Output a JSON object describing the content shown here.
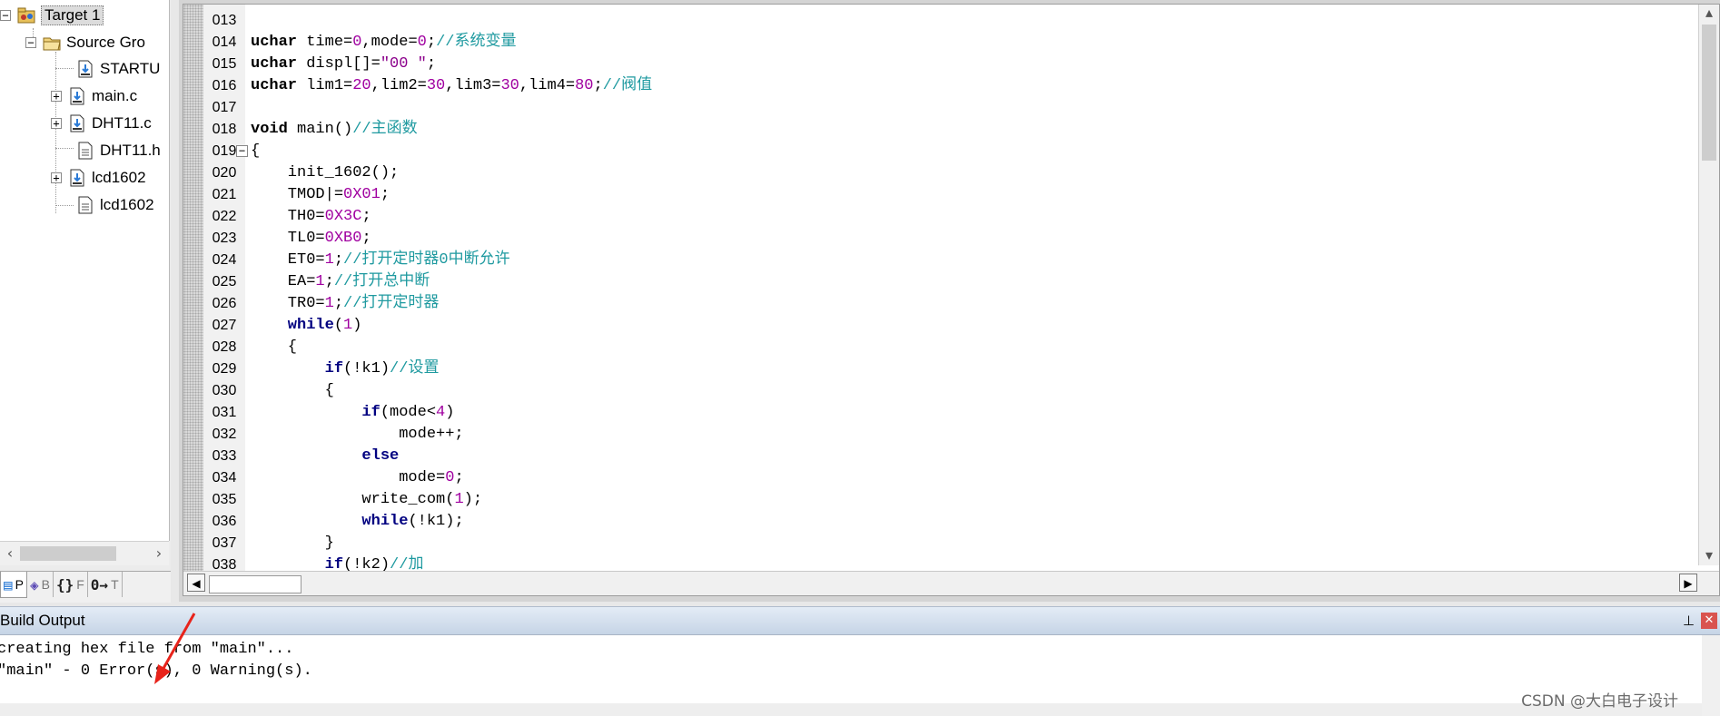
{
  "project": {
    "tree": [
      {
        "label": "Target 1",
        "expander": "⊟",
        "icon": "target-folder-icon",
        "selected": true
      },
      {
        "label": "Source Gro",
        "expander": "⊟",
        "icon": "folder-open-icon"
      },
      {
        "label": "STARTU",
        "expander": "",
        "icon": "asm-file-icon"
      },
      {
        "label": "main.c",
        "expander": "+",
        "icon": "c-file-icon"
      },
      {
        "label": "DHT11.c",
        "expander": "+",
        "icon": "c-file-icon"
      },
      {
        "label": "DHT11.h",
        "expander": "",
        "icon": "header-file-icon"
      },
      {
        "label": "lcd1602",
        "expander": "+",
        "icon": "c-file-icon"
      },
      {
        "label": "lcd1602",
        "expander": "",
        "icon": "header-file-icon"
      }
    ],
    "tabs": [
      {
        "glyph": "▤",
        "label": "P",
        "active": true
      },
      {
        "glyph": "◈",
        "label": "B"
      },
      {
        "glyph": "{}",
        "label": "F"
      },
      {
        "glyph": "0→",
        "label": "T"
      }
    ]
  },
  "editor": {
    "lines": [
      {
        "n": "013",
        "tokens": []
      },
      {
        "n": "014",
        "tokens": [
          [
            "kwp",
            "uchar"
          ],
          [
            "op",
            " time="
          ],
          [
            "num",
            "0"
          ],
          [
            "op",
            ",mode="
          ],
          [
            "num",
            "0"
          ],
          [
            "op",
            ";"
          ],
          [
            "cmt",
            "//系统变量"
          ]
        ]
      },
      {
        "n": "015",
        "tokens": [
          [
            "kwp",
            "uchar"
          ],
          [
            "op",
            " displ[]="
          ],
          [
            "str",
            "\"00 \""
          ],
          [
            "op",
            ";"
          ]
        ]
      },
      {
        "n": "016",
        "tokens": [
          [
            "kwp",
            "uchar"
          ],
          [
            "op",
            " lim1="
          ],
          [
            "num",
            "20"
          ],
          [
            "op",
            ",lim2="
          ],
          [
            "num",
            "30"
          ],
          [
            "op",
            ",lim3="
          ],
          [
            "num",
            "30"
          ],
          [
            "op",
            ",lim4="
          ],
          [
            "num",
            "80"
          ],
          [
            "op",
            ";"
          ],
          [
            "cmt",
            "//阀值"
          ]
        ]
      },
      {
        "n": "017",
        "tokens": []
      },
      {
        "n": "018",
        "tokens": [
          [
            "kwp",
            "void"
          ],
          [
            "op",
            " main()"
          ],
          [
            "cmt",
            "//主函数"
          ]
        ]
      },
      {
        "n": "019",
        "tokens": [
          [
            "op",
            "{"
          ]
        ],
        "fold": true
      },
      {
        "n": "020",
        "tokens": [
          [
            "op",
            "    init_1602();"
          ]
        ]
      },
      {
        "n": "021",
        "tokens": [
          [
            "op",
            "    TMOD|="
          ],
          [
            "num",
            "0X01"
          ],
          [
            "op",
            ";"
          ]
        ]
      },
      {
        "n": "022",
        "tokens": [
          [
            "op",
            "    TH0="
          ],
          [
            "num",
            "0X3C"
          ],
          [
            "op",
            ";"
          ]
        ]
      },
      {
        "n": "023",
        "tokens": [
          [
            "op",
            "    TL0="
          ],
          [
            "num",
            "0XB0"
          ],
          [
            "op",
            ";"
          ]
        ]
      },
      {
        "n": "024",
        "tokens": [
          [
            "op",
            "    ET0="
          ],
          [
            "num",
            "1"
          ],
          [
            "op",
            ";"
          ],
          [
            "cmt",
            "//打开定时器0中断允许"
          ]
        ]
      },
      {
        "n": "025",
        "tokens": [
          [
            "op",
            "    EA="
          ],
          [
            "num",
            "1"
          ],
          [
            "op",
            ";"
          ],
          [
            "cmt",
            "//打开总中断"
          ]
        ]
      },
      {
        "n": "026",
        "tokens": [
          [
            "op",
            "    TR0="
          ],
          [
            "num",
            "1"
          ],
          [
            "op",
            ";"
          ],
          [
            "cmt",
            "//打开定时器"
          ]
        ]
      },
      {
        "n": "027",
        "tokens": [
          [
            "kw",
            "    while"
          ],
          [
            "op",
            "("
          ],
          [
            "num",
            "1"
          ],
          [
            "op",
            ")"
          ]
        ]
      },
      {
        "n": "028",
        "tokens": [
          [
            "op",
            "    {"
          ]
        ]
      },
      {
        "n": "029",
        "tokens": [
          [
            "kw",
            "        if"
          ],
          [
            "op",
            "(!k1)"
          ],
          [
            "cmt",
            "//设置"
          ]
        ]
      },
      {
        "n": "030",
        "tokens": [
          [
            "op",
            "        {"
          ]
        ]
      },
      {
        "n": "031",
        "tokens": [
          [
            "kw",
            "            if"
          ],
          [
            "op",
            "(mode<"
          ],
          [
            "num",
            "4"
          ],
          [
            "op",
            ")"
          ]
        ]
      },
      {
        "n": "032",
        "tokens": [
          [
            "op",
            "                mode++;"
          ]
        ]
      },
      {
        "n": "033",
        "tokens": [
          [
            "kw",
            "            else"
          ]
        ]
      },
      {
        "n": "034",
        "tokens": [
          [
            "op",
            "                mode="
          ],
          [
            "num",
            "0"
          ],
          [
            "op",
            ";"
          ]
        ]
      },
      {
        "n": "035",
        "tokens": [
          [
            "op",
            "            write_com("
          ],
          [
            "num",
            "1"
          ],
          [
            "op",
            ");"
          ]
        ]
      },
      {
        "n": "036",
        "tokens": [
          [
            "kw",
            "            while"
          ],
          [
            "op",
            "(!k1);"
          ]
        ]
      },
      {
        "n": "037",
        "tokens": [
          [
            "op",
            "        }"
          ]
        ]
      },
      {
        "n": "038",
        "tokens": [
          [
            "kw",
            "        if"
          ],
          [
            "op",
            "(!k2)"
          ],
          [
            "cmt",
            "//加"
          ]
        ]
      }
    ]
  },
  "build": {
    "title": "Build Output",
    "lines": [
      "creating hex file from \"main\"...",
      "\"main\" - 0 Error(s), 0 Warning(s)."
    ],
    "pin_glyph": "⊥",
    "close_glyph": "✕"
  },
  "watermark": "CSDN @大白电子设计",
  "colors": {
    "keyword": "#000080",
    "number": "#a000a0",
    "comment": "#1f9aa0",
    "arrow": "#e8231b"
  }
}
